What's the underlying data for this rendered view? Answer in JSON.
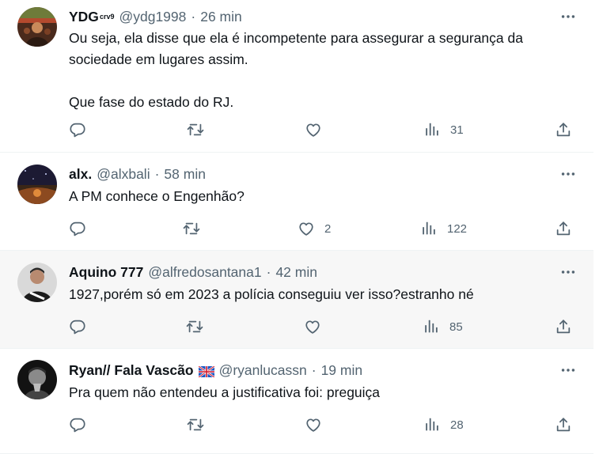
{
  "tweets": [
    {
      "display_name": "YDG",
      "name_suffix": "crv9",
      "handle": "@ydg1998",
      "dot": "·",
      "time": "26 min",
      "text": "Ou seja, ela disse que ela é incompetente para assegurar a segurança da sociedade em lugares assim.\n\nQue fase do estado do RJ.",
      "replies": "",
      "retweets": "",
      "likes": "",
      "views": "31"
    },
    {
      "display_name": "alx.",
      "handle": "@alxbali",
      "dot": "·",
      "time": "58 min",
      "text": "A PM conhece o Engenhão?",
      "replies": "",
      "retweets": "",
      "likes": "2",
      "views": "122"
    },
    {
      "display_name": "Aquino 777",
      "handle": "@alfredosantana1",
      "dot": "·",
      "time": "42 min",
      "text": "1927,porém só em 2023 a polícia conseguiu ver isso?estranho né",
      "replies": "",
      "retweets": "",
      "likes": "",
      "views": "85"
    },
    {
      "display_name": "Ryan// Fala Vascão",
      "handle": "@ryanlucassn",
      "dot": "·",
      "time": "19 min",
      "text": "Pra quem não entendeu a justificativa foi: preguiça",
      "replies": "",
      "retweets": "",
      "likes": "",
      "views": "28"
    }
  ],
  "icons": {
    "more": "more-dots-icon",
    "reply": "reply-bubble-icon",
    "retweet": "retweet-arrows-icon",
    "like": "heart-icon",
    "views": "bar-chart-icon",
    "share": "share-upload-icon",
    "flag": "flag-emoji-icon"
  },
  "colors": {
    "text": "#0f1419",
    "secondary": "#536471",
    "divider": "#eff3f4",
    "hover_bg": "#f7f7f7"
  }
}
